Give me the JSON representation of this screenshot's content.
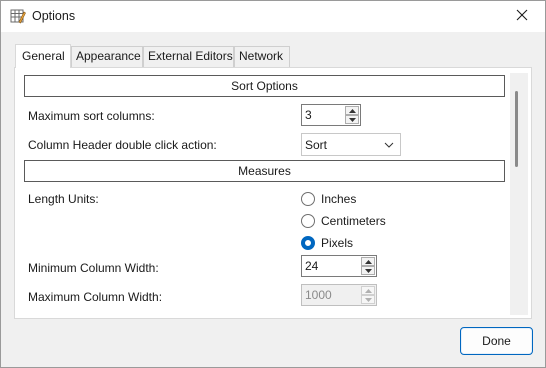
{
  "window": {
    "title": "Options",
    "icon": "options-grid-icon",
    "close_icon": "close-icon"
  },
  "tabs": [
    {
      "label": "General",
      "active": true
    },
    {
      "label": "Appearance",
      "active": false
    },
    {
      "label": "External Editors",
      "active": false
    },
    {
      "label": "Network",
      "active": false
    }
  ],
  "sort_options": {
    "header": "Sort Options",
    "max_sort_columns_label": "Maximum sort columns:",
    "max_sort_columns_value": "3",
    "header_dblclick_label": "Column Header double click action:",
    "header_dblclick_value": "Sort"
  },
  "measures": {
    "header": "Measures",
    "length_units_label": "Length Units:",
    "units": [
      {
        "label": "Inches",
        "checked": false
      },
      {
        "label": "Centimeters",
        "checked": false
      },
      {
        "label": "Pixels",
        "checked": true
      }
    ],
    "min_col_width_label": "Minimum Column Width:",
    "min_col_width_value": "24",
    "max_col_width_label": "Maximum Column Width:",
    "max_col_width_value": "1000",
    "max_col_width_enabled": false
  },
  "footer": {
    "done_label": "Done"
  },
  "colors": {
    "accent": "#0067c0",
    "window_bg": "#f0f0f0",
    "panel_bg": "#ffffff"
  }
}
